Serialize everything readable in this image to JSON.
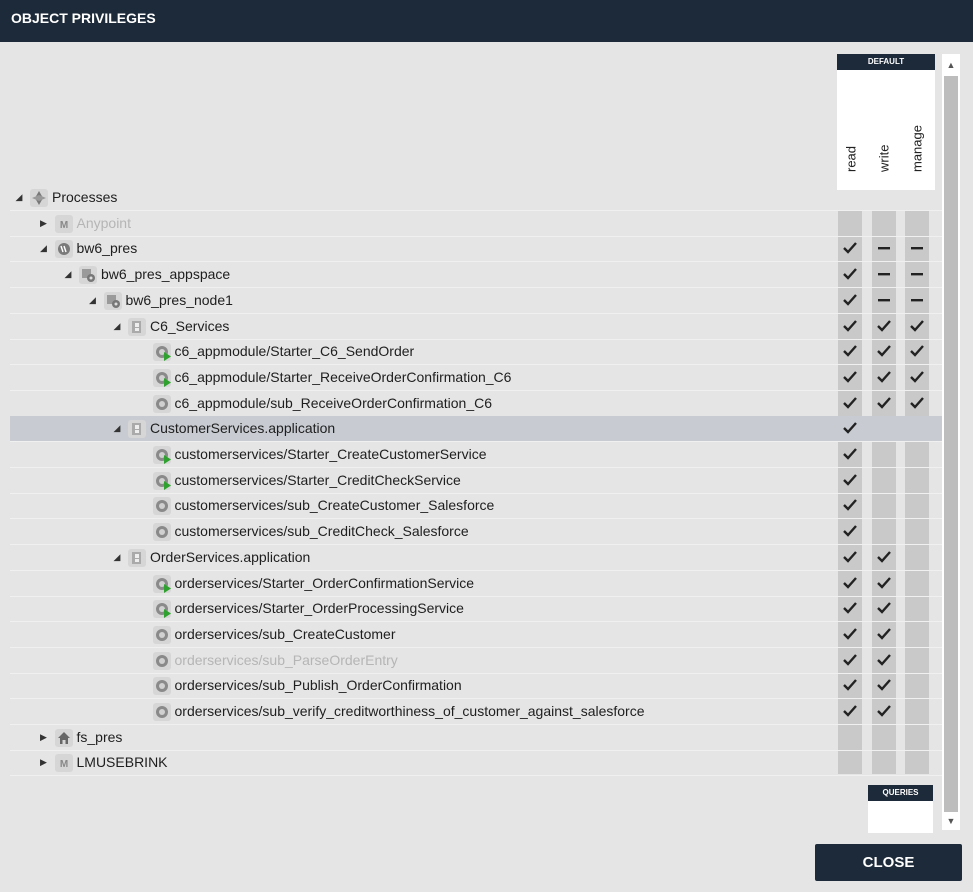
{
  "dialog": {
    "title": "OBJECT PRIVILEGES",
    "close_label": "CLOSE"
  },
  "default_group": {
    "label": "DEFAULT",
    "columns": [
      "read",
      "write",
      "manage"
    ]
  },
  "queries_label": "QUERIES",
  "tree": [
    {
      "label": "Processes",
      "level": 0,
      "caret": "expanded",
      "icon": "processes-icon",
      "dim": false,
      "selected": false,
      "perms": [
        "none",
        "none",
        "none"
      ],
      "cells": false
    },
    {
      "label": "Anypoint",
      "level": 1,
      "caret": "collapsed",
      "icon": "mule-icon",
      "dim": true,
      "selected": false,
      "perms": [
        "none",
        "none",
        "none"
      ],
      "cells": true
    },
    {
      "label": "bw6_pres",
      "level": 1,
      "caret": "expanded",
      "icon": "bw-icon",
      "dim": false,
      "selected": false,
      "perms": [
        "check",
        "dash",
        "dash"
      ],
      "cells": true
    },
    {
      "label": "bw6_pres_appspace",
      "level": 2,
      "caret": "expanded",
      "icon": "appspace-icon",
      "dim": false,
      "selected": false,
      "perms": [
        "check",
        "dash",
        "dash"
      ],
      "cells": true
    },
    {
      "label": "bw6_pres_node1",
      "level": 3,
      "caret": "expanded",
      "icon": "appnode-icon",
      "dim": false,
      "selected": false,
      "perms": [
        "check",
        "dash",
        "dash"
      ],
      "cells": true
    },
    {
      "label": "C6_Services",
      "level": 4,
      "caret": "expanded",
      "icon": "application-icon",
      "dim": false,
      "selected": false,
      "perms": [
        "check",
        "check",
        "check"
      ],
      "cells": true
    },
    {
      "label": "c6_appmodule/Starter_C6_SendOrder",
      "level": 5,
      "caret": "none",
      "icon": "starter-process-icon",
      "dim": false,
      "selected": false,
      "perms": [
        "check",
        "check",
        "check"
      ],
      "cells": true
    },
    {
      "label": "c6_appmodule/Starter_ReceiveOrderConfirmation_C6",
      "level": 5,
      "caret": "none",
      "icon": "starter-process-icon",
      "dim": false,
      "selected": false,
      "perms": [
        "check",
        "check",
        "check"
      ],
      "cells": true
    },
    {
      "label": "c6_appmodule/sub_ReceiveOrderConfirmation_C6",
      "level": 5,
      "caret": "none",
      "icon": "process-icon",
      "dim": false,
      "selected": false,
      "perms": [
        "check",
        "check",
        "check"
      ],
      "cells": true
    },
    {
      "label": "CustomerServices.application",
      "level": 4,
      "caret": "expanded",
      "icon": "application-icon",
      "dim": false,
      "selected": true,
      "perms": [
        "check",
        "none",
        "none"
      ],
      "cells": true
    },
    {
      "label": "customerservices/Starter_CreateCustomerService",
      "level": 5,
      "caret": "none",
      "icon": "starter-process-icon",
      "dim": false,
      "selected": false,
      "perms": [
        "check",
        "none",
        "none"
      ],
      "cells": true
    },
    {
      "label": "customerservices/Starter_CreditCheckService",
      "level": 5,
      "caret": "none",
      "icon": "starter-process-icon",
      "dim": false,
      "selected": false,
      "perms": [
        "check",
        "none",
        "none"
      ],
      "cells": true
    },
    {
      "label": "customerservices/sub_CreateCustomer_Salesforce",
      "level": 5,
      "caret": "none",
      "icon": "process-icon",
      "dim": false,
      "selected": false,
      "perms": [
        "check",
        "none",
        "none"
      ],
      "cells": true
    },
    {
      "label": "customerservices/sub_CreditCheck_Salesforce",
      "level": 5,
      "caret": "none",
      "icon": "process-icon",
      "dim": false,
      "selected": false,
      "perms": [
        "check",
        "none",
        "none"
      ],
      "cells": true
    },
    {
      "label": "OrderServices.application",
      "level": 4,
      "caret": "expanded",
      "icon": "application-icon",
      "dim": false,
      "selected": false,
      "perms": [
        "check",
        "check",
        "none"
      ],
      "cells": true
    },
    {
      "label": "orderservices/Starter_OrderConfirmationService",
      "level": 5,
      "caret": "none",
      "icon": "starter-process-icon",
      "dim": false,
      "selected": false,
      "perms": [
        "check",
        "check",
        "none"
      ],
      "cells": true
    },
    {
      "label": "orderservices/Starter_OrderProcessingService",
      "level": 5,
      "caret": "none",
      "icon": "starter-process-icon",
      "dim": false,
      "selected": false,
      "perms": [
        "check",
        "check",
        "none"
      ],
      "cells": true
    },
    {
      "label": "orderservices/sub_CreateCustomer",
      "level": 5,
      "caret": "none",
      "icon": "process-icon",
      "dim": false,
      "selected": false,
      "perms": [
        "check",
        "check",
        "none"
      ],
      "cells": true
    },
    {
      "label": "orderservices/sub_ParseOrderEntry",
      "level": 5,
      "caret": "none",
      "icon": "process-icon",
      "dim": true,
      "selected": false,
      "perms": [
        "check",
        "check",
        "none"
      ],
      "cells": true
    },
    {
      "label": "orderservices/sub_Publish_OrderConfirmation",
      "level": 5,
      "caret": "none",
      "icon": "process-icon",
      "dim": false,
      "selected": false,
      "perms": [
        "check",
        "check",
        "none"
      ],
      "cells": true
    },
    {
      "label": "orderservices/sub_verify_creditworthiness_of_customer_against_salesforce",
      "level": 5,
      "caret": "none",
      "icon": "process-icon",
      "dim": false,
      "selected": false,
      "perms": [
        "check",
        "check",
        "none"
      ],
      "cells": true
    },
    {
      "label": "fs_pres",
      "level": 1,
      "caret": "collapsed",
      "icon": "home-icon",
      "dim": false,
      "selected": false,
      "perms": [
        "none",
        "none",
        "none"
      ],
      "cells": true
    },
    {
      "label": "LMUSEBRINK",
      "level": 1,
      "caret": "collapsed",
      "icon": "mule-icon",
      "dim": false,
      "selected": false,
      "perms": [
        "none",
        "none",
        "none"
      ],
      "cells": true
    }
  ],
  "colors": {
    "titlebar": "#1d2a39",
    "check": "#222222",
    "starter_arrow": "#2ea12e"
  }
}
